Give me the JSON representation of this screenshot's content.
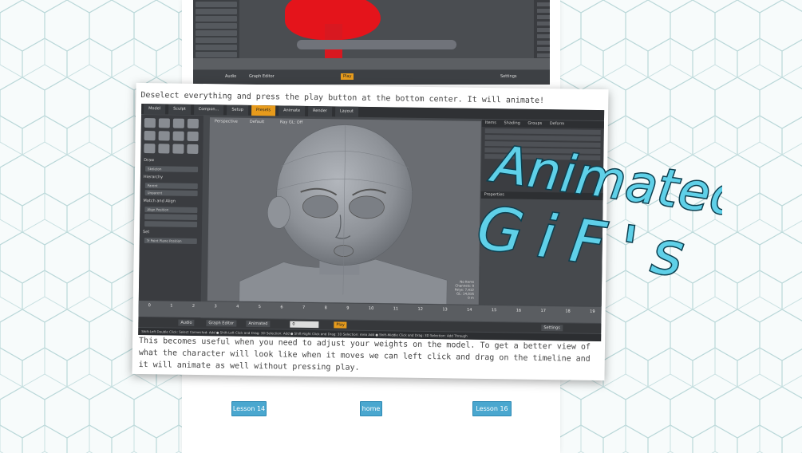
{
  "overlay_title": {
    "line1": "Animated",
    "line2": "GiF's"
  },
  "back_screenshot": {
    "play_label": "Play",
    "settings_label": "Settings",
    "audio_label": "Audio",
    "graph_label": "Graph Editor"
  },
  "card": {
    "caption_top": "Deselect everything and press the play button at the bottom center. It will animate!",
    "caption_bottom": "This becomes useful when you need to adjust your weights on the model. To get a better view of what the character will look like when it moves we can left click and drag on the timeline and it will animate as well without pressing play."
  },
  "app": {
    "tabs": [
      "Model",
      "Sculpt",
      "Compon...",
      "Setup",
      "Presets",
      "Animate",
      "Render",
      "Layout"
    ],
    "viewport_labels": [
      "Perspective",
      "Default",
      "Ray GL: Off"
    ],
    "tools_sections": [
      "Draw",
      "Skeleton",
      "Hierarchy",
      "Parent",
      "Unparent",
      "Match and Align",
      "Align Position",
      "Set",
      "Tr Point Plane Position"
    ],
    "right_panel": {
      "tabs": [
        "Items",
        "Shading",
        "Groups",
        "Deform"
      ],
      "lower_tab": "Properties"
    },
    "timeline_ticks": [
      "0",
      "1",
      "2",
      "3",
      "4",
      "5",
      "6",
      "7",
      "8",
      "9",
      "10",
      "11",
      "12",
      "13",
      "14",
      "15",
      "16",
      "17",
      "18",
      "19"
    ],
    "bottom_bar": {
      "audio": "Audio",
      "graph": "Graph Editor",
      "mode": "Animated",
      "frame": "0",
      "play": "Play",
      "settings": "Settings"
    },
    "status_text": "Shift-Left Double Click: Select Connected: Add ● Shift-Left Click and Drag: 3D Selection: Add ● Shift-Right Click and Drag: 3D Selection: Area Add ● Shift-Middle Click and Drag: 3D Selection: Add Through",
    "viewport_info": [
      "No Items",
      "Channels: 0",
      "Polys: 7,412",
      "GL: 14,816",
      "0 m"
    ]
  },
  "nav": {
    "prev": "Lesson 14",
    "home": "home",
    "next": "Lesson 16"
  },
  "colors": {
    "accent": "#e79b1c",
    "title_fill": "#5fd0e8",
    "title_stroke": "#0d3f4f",
    "nav": "#4aa7cf"
  }
}
